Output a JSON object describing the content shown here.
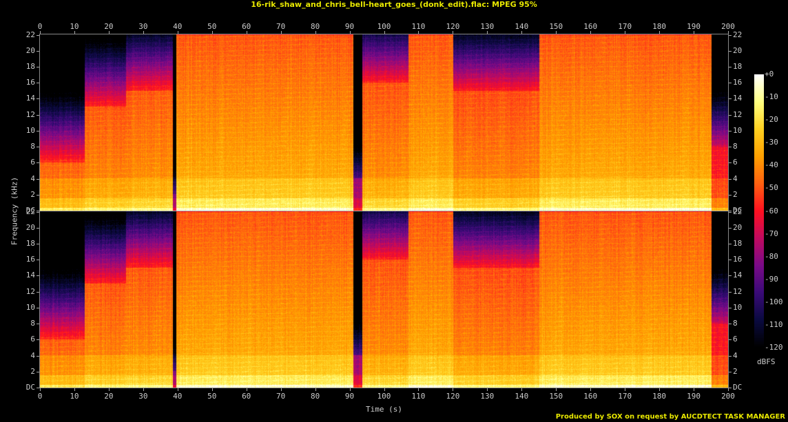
{
  "chart_data": {
    "type": "heatmap",
    "title": "16-rik_shaw_and_chris_bell-heart_goes_(donk_edit).flac: MPEG 95%",
    "xlabel": "Time (s)",
    "ylabel": "Frequency (kHz)",
    "xlim": [
      0,
      200
    ],
    "ylim": [
      0,
      22
    ],
    "x_ticks": [
      "0",
      "10",
      "20",
      "30",
      "40",
      "50",
      "60",
      "70",
      "80",
      "90",
      "100",
      "110",
      "120",
      "130",
      "140",
      "150",
      "160",
      "170",
      "180",
      "190",
      "200"
    ],
    "y_ticks": [
      "DC",
      "2",
      "4",
      "6",
      "8",
      "10",
      "12",
      "14",
      "16",
      "18",
      "20",
      "22"
    ],
    "channels": [
      "left",
      "right"
    ],
    "colorbar": {
      "label": "dBFS",
      "ticks": [
        "+0",
        "-10",
        "-20",
        "-30",
        "-40",
        "-50",
        "-60",
        "-70",
        "-80",
        "-90",
        "-100",
        "-110",
        "-120"
      ],
      "range": [
        -120,
        0
      ],
      "colors": [
        "#000000",
        "#0a0a40",
        "#3a0a78",
        "#7a0a88",
        "#c00a60",
        "#ff1020",
        "#ff6010",
        "#ffa000",
        "#ffd020",
        "#ffff80",
        "#ffffff"
      ]
    },
    "segments": [
      {
        "start": 0,
        "end": 13,
        "level_db": -42,
        "rolloff_khz": 6
      },
      {
        "start": 13,
        "end": 25,
        "level_db": -38,
        "rolloff_khz": 13
      },
      {
        "start": 25,
        "end": 38.5,
        "level_db": -36,
        "rolloff_khz": 15
      },
      {
        "start": 38.5,
        "end": 39.5,
        "level_db": -90,
        "rolloff_khz": 2
      },
      {
        "start": 39.5,
        "end": 91,
        "level_db": -30,
        "rolloff_khz": 22
      },
      {
        "start": 91,
        "end": 93.5,
        "level_db": -80,
        "rolloff_khz": 4
      },
      {
        "start": 93.5,
        "end": 107,
        "level_db": -36,
        "rolloff_khz": 16
      },
      {
        "start": 107,
        "end": 120,
        "level_db": -30,
        "rolloff_khz": 22
      },
      {
        "start": 120,
        "end": 145,
        "level_db": -38,
        "rolloff_khz": 15
      },
      {
        "start": 145,
        "end": 195,
        "level_db": -30,
        "rolloff_khz": 22
      },
      {
        "start": 195,
        "end": 200,
        "level_db": -55,
        "rolloff_khz": 8
      }
    ]
  },
  "footer": "Produced by SOX on request by AUCDTECT TASK MANAGER"
}
